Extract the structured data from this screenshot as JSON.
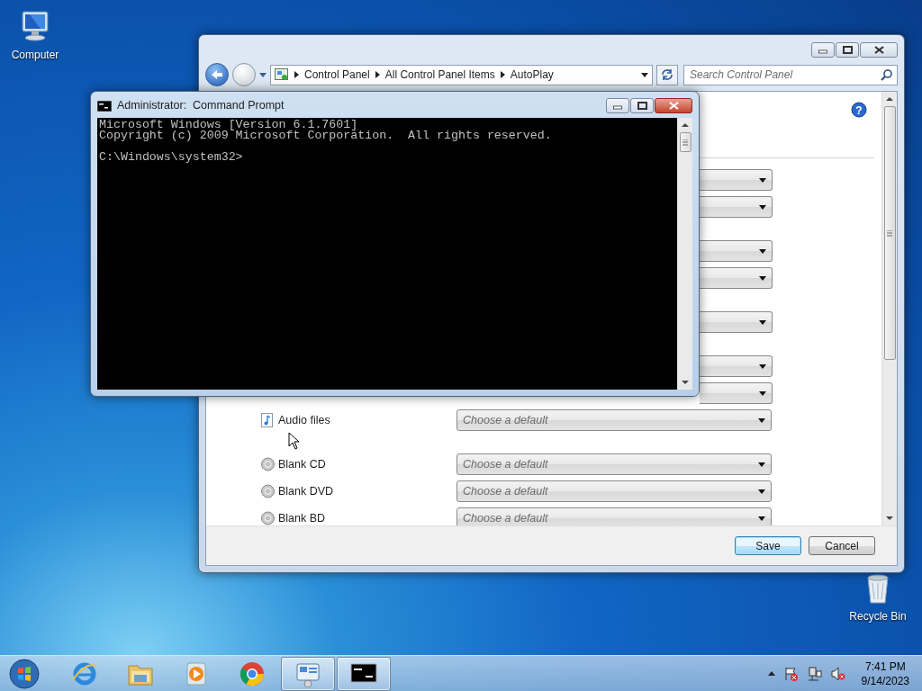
{
  "desktop_icons": [
    {
      "kind": "computer",
      "label": "Computer"
    },
    {
      "kind": "recycle",
      "label": "Recycle Bin"
    }
  ],
  "control_panel": {
    "breadcrumb": [
      "Control Panel",
      "All Control Panel Items",
      "AutoPlay"
    ],
    "search": {
      "placeholder": "Search Control Panel"
    },
    "help_glyph": "?",
    "groups": [
      {
        "rows": [
          {
            "kind": "covered"
          },
          {
            "kind": "covered"
          }
        ]
      },
      {
        "rows": [
          {
            "kind": "covered"
          },
          {
            "kind": "covered"
          }
        ]
      },
      {
        "rows": [
          {
            "kind": "covered"
          }
        ]
      },
      {
        "rows": [
          {
            "kind": "covered"
          },
          {
            "kind": "covered"
          },
          {
            "kind": "audio",
            "label": "Audio files",
            "value": "Choose a default"
          }
        ]
      },
      {
        "rows": [
          {
            "kind": "disc",
            "label": "Blank CD",
            "value": "Choose a default"
          },
          {
            "kind": "disc",
            "label": "Blank DVD",
            "value": "Choose a default"
          },
          {
            "kind": "disc",
            "label": "Blank BD",
            "value": "Choose a default"
          }
        ]
      }
    ],
    "buttons": [
      {
        "label": "Save",
        "default": true
      },
      {
        "label": "Cancel",
        "default": false
      }
    ]
  },
  "command_prompt": {
    "title": "Administrator:  Command Prompt",
    "output": "Microsoft Windows [Version 6.1.7601]\nCopyright (c) 2009 Microsoft Corporation.  All rights reserved.\n\nC:\\Windows\\system32>"
  },
  "taskbar": {
    "apps": [
      {
        "kind": "browser-e",
        "running": false
      },
      {
        "kind": "folder",
        "running": false
      },
      {
        "kind": "media",
        "running": false
      },
      {
        "kind": "chrome",
        "running": false
      },
      {
        "kind": "control",
        "running": true
      },
      {
        "kind": "console",
        "running": true
      }
    ],
    "clock": {
      "time": "7:41 PM",
      "date": "9/14/2023"
    }
  }
}
